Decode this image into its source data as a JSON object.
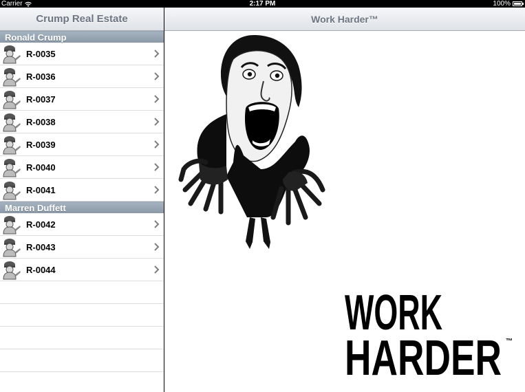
{
  "status_bar": {
    "carrier": "Carrier",
    "time": "2:17 PM",
    "battery": "100%",
    "battery_level": 1.0
  },
  "master": {
    "title": "Crump Real Estate",
    "sections": [
      {
        "header": "Ronald Crump",
        "rows": [
          "R-0035",
          "R-0036",
          "R-0037",
          "R-0038",
          "R-0039",
          "R-0040",
          "R-0041"
        ]
      },
      {
        "header": "Marren Duffett",
        "rows": [
          "R-0042",
          "R-0043",
          "R-0044"
        ]
      }
    ],
    "row_icon": "worker-avatar-icon",
    "row_accessory": "chevron-right-icon"
  },
  "detail": {
    "title": "Work Harder™",
    "image": "screaming-woman-image",
    "wordmark_line1": "WORK",
    "wordmark_line2": "HARDER",
    "wordmark_tm": "™"
  },
  "colors": {
    "nav_text": "#6d7583",
    "section_header_bg": "#97a5b3",
    "status_bar_bg": "#000000"
  }
}
